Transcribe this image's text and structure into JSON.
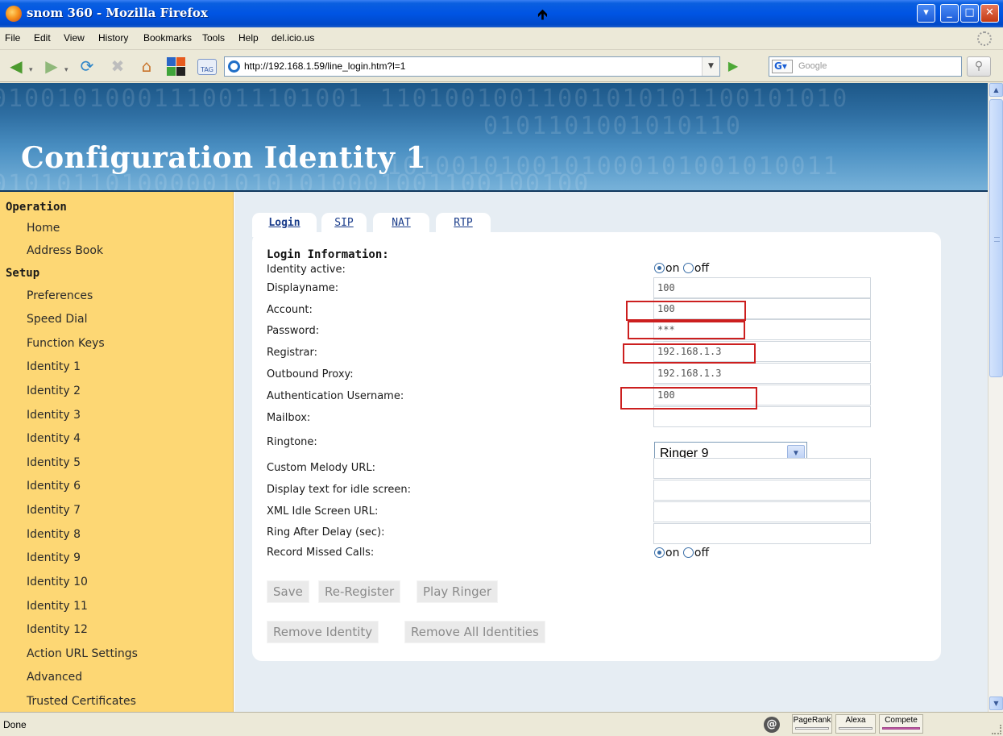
{
  "window": {
    "title": "snom 360 - Mozilla Firefox"
  },
  "menu": [
    "File",
    "Edit",
    "View",
    "History",
    "Bookmarks",
    "Tools",
    "Help",
    "del.icio.us"
  ],
  "toolbar": {
    "url": "http://192.168.1.59/line_login.htm?l=1",
    "search_placeholder": "Google",
    "tag_label": "TAG"
  },
  "page": {
    "heading": "Configuration Identity 1"
  },
  "sidebar": {
    "operation_title": "Operation",
    "operation_items": [
      "Home",
      "Address Book"
    ],
    "setup_title": "Setup",
    "setup_items": [
      "Preferences",
      "Speed Dial",
      "Function Keys",
      "Identity 1",
      "Identity 2",
      "Identity 3",
      "Identity 4",
      "Identity 5",
      "Identity 6",
      "Identity 7",
      "Identity 8",
      "Identity 9",
      "Identity 10",
      "Identity 11",
      "Identity 12",
      "Action URL Settings",
      "Advanced",
      "Trusted Certificates"
    ]
  },
  "tabs": [
    "Login",
    "SIP",
    "NAT",
    "RTP"
  ],
  "form": {
    "section_title": "Login Information:",
    "identity_active": {
      "label": "Identity active:",
      "on": "on",
      "off": "off",
      "value": "on"
    },
    "displayname": {
      "label": "Displayname:",
      "value": "100"
    },
    "account": {
      "label": "Account:",
      "value": "100"
    },
    "password": {
      "label": "Password:",
      "value": "***"
    },
    "registrar": {
      "label": "Registrar:",
      "value": "192.168.1.3"
    },
    "outbound_proxy": {
      "label": "Outbound Proxy:",
      "value": "192.168.1.3"
    },
    "auth_username": {
      "label": "Authentication Username:",
      "value": "100"
    },
    "mailbox": {
      "label": "Mailbox:",
      "value": ""
    },
    "ringtone": {
      "label": "Ringtone:",
      "value": "Ringer 9"
    },
    "custom_melody": {
      "label": "Custom Melody URL:",
      "value": ""
    },
    "idle_text": {
      "label": "Display text for idle screen:",
      "value": ""
    },
    "xml_idle": {
      "label": "XML Idle Screen URL:",
      "value": ""
    },
    "ring_delay": {
      "label": "Ring After Delay (sec):",
      "value": ""
    },
    "record_missed": {
      "label": "Record Missed Calls:",
      "on": "on",
      "off": "off",
      "value": "on"
    }
  },
  "buttons": {
    "save": "Save",
    "reregister": "Re-Register",
    "play_ringer": "Play Ringer",
    "remove_identity": "Remove Identity",
    "remove_all": "Remove All Identities"
  },
  "status": {
    "text": "Done",
    "pagerank": "PageRank",
    "alexa": "Alexa",
    "compete": "Compete"
  },
  "colors": {
    "sidebar_bg": "#FDD774",
    "main_bg": "#E6EDF3",
    "highlight": "#CC1F1F",
    "titlebar": "#0054E3"
  }
}
